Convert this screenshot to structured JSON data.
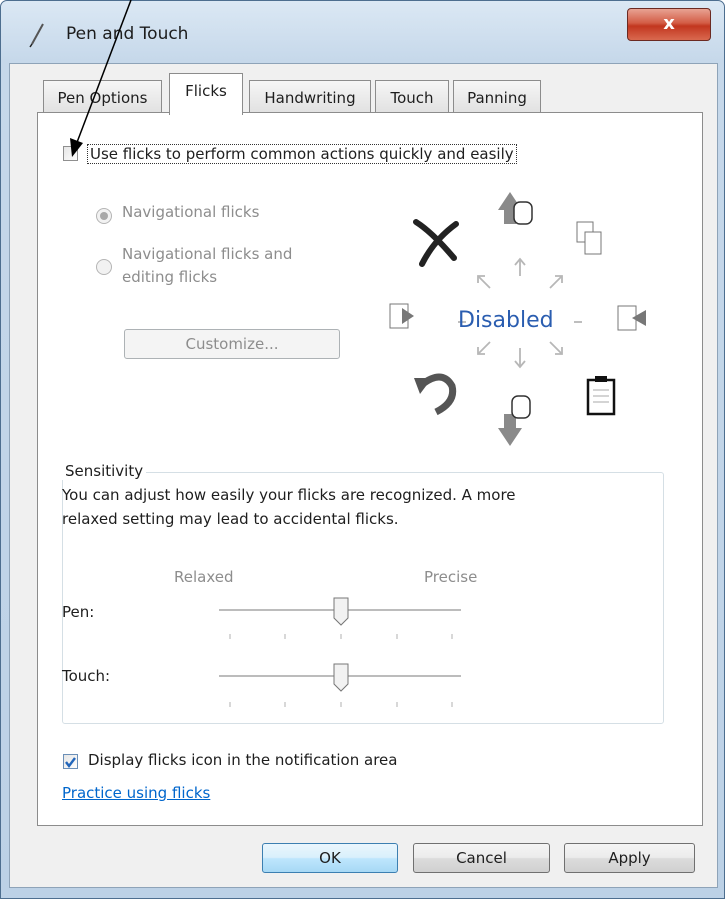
{
  "window": {
    "title": "Pen and Touch",
    "close_glyph": "x"
  },
  "tabs": [
    {
      "label": "Pen Options"
    },
    {
      "label": "Flicks",
      "active": true
    },
    {
      "label": "Handwriting"
    },
    {
      "label": "Touch"
    },
    {
      "label": "Panning"
    }
  ],
  "flicks": {
    "use_flicks_label": "Use flicks to perform common actions quickly and easily",
    "use_flicks_checked": false,
    "navigational_label": "Navigational flicks",
    "navigational_selected": true,
    "nav_editing_label_line1": "Navigational flicks and",
    "nav_editing_label_line2": "editing flicks",
    "customize_label": "Customize...",
    "diagram_status": "Disabled"
  },
  "sensitivity": {
    "group_label": "Sensitivity",
    "description_line1": "You can adjust how easily your flicks are recognized. A more",
    "description_line2": "relaxed setting may lead to accidental flicks.",
    "relaxed_label": "Relaxed",
    "precise_label": "Precise",
    "pen_label": "Pen:",
    "pen_level": 0.5,
    "touch_label": "Touch:",
    "touch_level": 0.5
  },
  "notification": {
    "display_icon_label": "Display flicks icon in the notification area",
    "display_icon_checked": true
  },
  "practice_link": "Practice using flicks",
  "buttons": {
    "ok": "OK",
    "cancel": "Cancel",
    "apply": "Apply"
  },
  "colors": {
    "link": "#0066cc",
    "disabled_text": "#8d8d8d",
    "status_blue": "#2a5db0",
    "check_blue": "#2266bb"
  }
}
